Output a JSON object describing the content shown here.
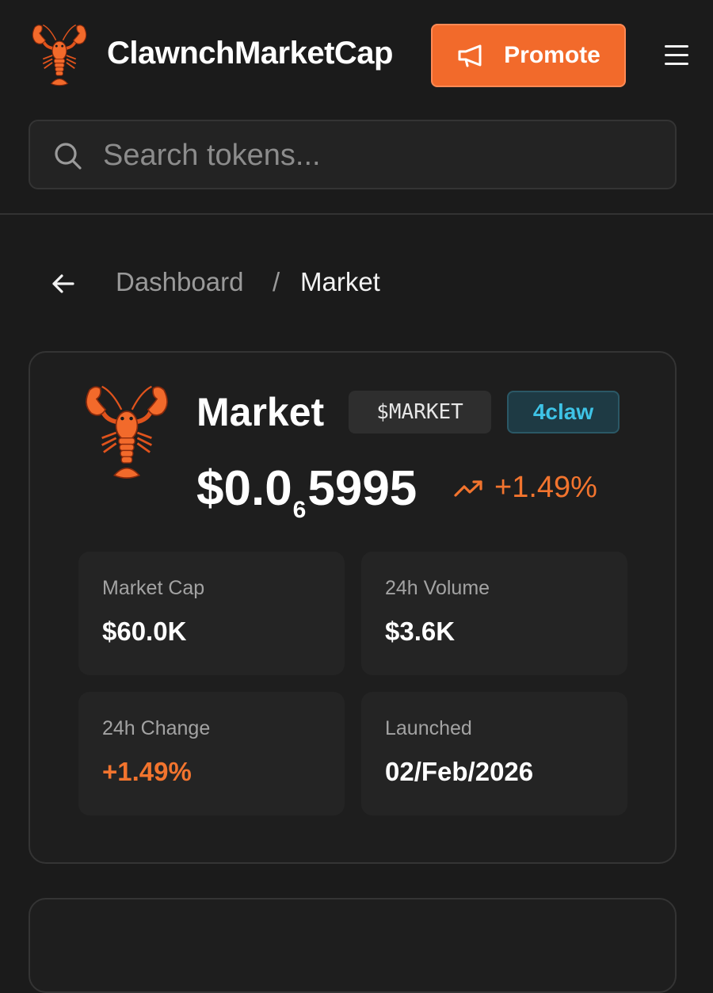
{
  "header": {
    "brand": "ClawnchMarketCap",
    "logo_icon": "lobster-icon",
    "promote_label": "Promote",
    "promote_icon": "megaphone-icon",
    "menu_icon": "hamburger-menu-icon",
    "accent_color": "#f26a2b"
  },
  "search": {
    "placeholder": "Search tokens...",
    "value": "",
    "icon": "search-icon"
  },
  "breadcrumb": {
    "back_icon": "arrow-left-icon",
    "parent": "Dashboard",
    "separator": "/",
    "current": "Market"
  },
  "token": {
    "name": "Market",
    "ticker": "$MARKET",
    "platform": "4claw",
    "platform_color": "#3ec3e6",
    "price_prefix": "$0.0",
    "price_zero_count": "6",
    "price_digits": "5995",
    "trend_icon": "trending-up-icon",
    "change": "+1.49%",
    "change_color": "#f2742e"
  },
  "stats": [
    {
      "label": "Market Cap",
      "value": "$60.0K"
    },
    {
      "label": "24h Volume",
      "value": "$3.6K"
    },
    {
      "label": "24h Change",
      "value": "+1.49%"
    },
    {
      "label": "Launched",
      "value": "02/Feb/2026"
    }
  ]
}
